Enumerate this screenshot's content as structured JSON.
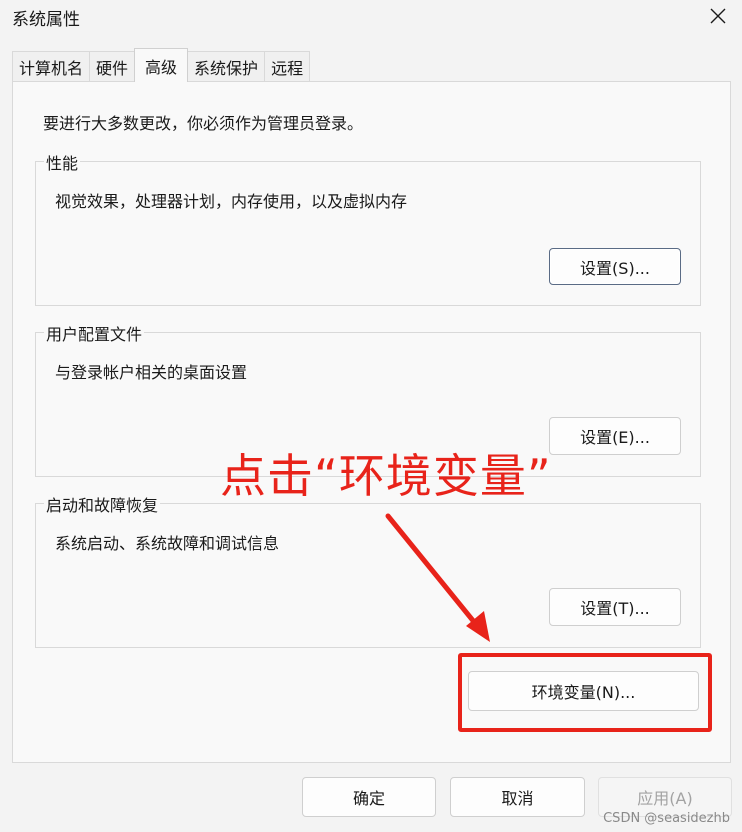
{
  "window": {
    "title": "系统属性"
  },
  "tabs": [
    {
      "label": "计算机名"
    },
    {
      "label": "硬件"
    },
    {
      "label": "高级"
    },
    {
      "label": "系统保护"
    },
    {
      "label": "远程"
    }
  ],
  "main": {
    "intro": "要进行大多数更改，你必须作为管理员登录。",
    "performance": {
      "label": "性能",
      "desc": "视觉效果，处理器计划，内存使用，以及虚拟内存",
      "button": "设置(S)..."
    },
    "user_profiles": {
      "label": "用户配置文件",
      "desc": "与登录帐户相关的桌面设置",
      "button": "设置(E)..."
    },
    "startup_recovery": {
      "label": "启动和故障恢复",
      "desc": "系统启动、系统故障和调试信息",
      "button": "设置(T)..."
    },
    "env_button": "环境变量(N)..."
  },
  "footer": {
    "ok": "确定",
    "cancel": "取消",
    "apply": "应用(A)"
  },
  "annotation": {
    "text": "点击“环境变量”",
    "color": "#e8231a"
  },
  "watermark": "CSDN @seasidezhb"
}
